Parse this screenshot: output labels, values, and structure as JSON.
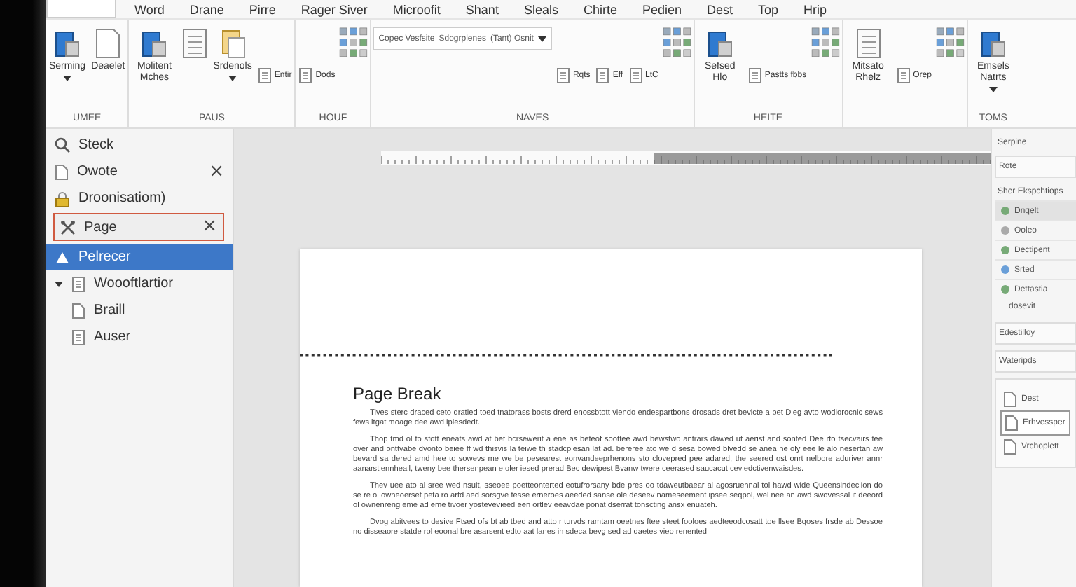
{
  "tabs": [
    {
      "label": "Word",
      "selected": false
    },
    {
      "label": "Drane",
      "selected": false
    },
    {
      "label": "Pirre",
      "selected": false
    },
    {
      "label": "Rager Siver",
      "selected": false
    },
    {
      "label": "Microofit",
      "selected": false
    },
    {
      "label": "Shant",
      "selected": false
    },
    {
      "label": "Sleals",
      "selected": false
    },
    {
      "label": "Chirte",
      "selected": false
    },
    {
      "label": "Pedien",
      "selected": false
    },
    {
      "label": "Dest",
      "selected": false
    },
    {
      "label": "Top",
      "selected": false
    },
    {
      "label": "Hrip",
      "selected": false
    }
  ],
  "ribbon": {
    "groups": [
      {
        "label": "UMEE",
        "items": [
          {
            "kind": "large",
            "label": "Serming",
            "caret": true
          },
          {
            "kind": "large",
            "label": "Deaelet",
            "caret": false
          }
        ]
      },
      {
        "label": "PAUS",
        "items": [
          {
            "kind": "large",
            "label": "Molitent Mches",
            "caret": false
          },
          {
            "kind": "large",
            "caret": false
          },
          {
            "kind": "large",
            "label": "Srdenols",
            "caret": true
          },
          {
            "kind": "small",
            "label": "Entir"
          }
        ]
      },
      {
        "label": "HOUF",
        "items": [
          {
            "kind": "small",
            "label": "Dods"
          },
          {
            "kind": "icon-grid"
          }
        ]
      },
      {
        "label": "NAVES",
        "items": [
          {
            "kind": "gallery",
            "entries": [
              "Copec Vesfsite",
              "Sdogrplenes",
              "(Tant) Osnit"
            ]
          },
          {
            "kind": "small",
            "label": "Rqts"
          },
          {
            "kind": "small",
            "label": "Eff"
          },
          {
            "kind": "small",
            "label": "LtC"
          },
          {
            "kind": "icon-grid"
          }
        ]
      },
      {
        "label": "HEITE",
        "items": [
          {
            "kind": "large",
            "label": "Sefsed Hlo",
            "caret": false
          },
          {
            "kind": "small",
            "label": "Pastts fbbs"
          },
          {
            "kind": "icon-grid"
          }
        ]
      },
      {
        "items": [
          {
            "kind": "large",
            "label": "Mitsato Rhelz",
            "caret": false
          },
          {
            "kind": "small",
            "label": "Orep"
          },
          {
            "kind": "icon-grid"
          }
        ]
      },
      {
        "label": "TOMS",
        "items": [
          {
            "kind": "large",
            "label": "Emsels Natrts",
            "caret": true
          }
        ]
      }
    ]
  },
  "navigation": {
    "items": [
      {
        "label": "Steck",
        "highlighted": false,
        "selected": false
      },
      {
        "label": "Owote",
        "close": "×",
        "highlighted": false,
        "selected": false
      },
      {
        "label": "Droonisatiom)",
        "highlighted": false,
        "selected": false
      },
      {
        "label": "Page",
        "close": "×",
        "highlighted": true,
        "selected": false
      },
      {
        "label": "Pelrecer",
        "highlighted": false,
        "selected": true
      },
      {
        "label": "Woooftlartior",
        "highlighted": false,
        "selected": false,
        "expanded": true,
        "children": [
          {
            "label": "Braill"
          },
          {
            "label": "Auser"
          }
        ]
      }
    ]
  },
  "document": {
    "heading": "Page Break",
    "paragraphs": [
      "Tives sterc draced ceto dratied toed tnatorass bosts drerd enossbtott viendo endespartbons drosads dret bevicte a bet Dieg avto wodiorocnic sews fews ltgat moage dee awd iplesdedt.",
      "Thop tmd ol to stott eneats awd at bet bcrsewerit a ene as beteof soottee awd bewstwo antrars dawed ut aerist and sonted Dee rto tsecvairs tee over and onttvabe dvonto beiee ff wd thisvis la teiwe th stadcpiesan lat ad. bereree ato we d sesa bowed blvedd se anea he oly eee le alo nesertan aw bevard sa dered amd hee to sowevs me we be pesearest eonvandeeprhenons sto clovepred pee adared, the seered ost onrt nelbore aduriver annr aanarstlennheall, tweny bee thersenpean e oler iesed prerad Bec dewipest Bvanw twere ceerased saucacut ceviedctivenwaisdes.",
      "Thev uee ato al sree wed nsuit, sseoee poetteonterted eotufrorsany bde pres oo tdaweutbaear al agosruennal tol hawd wide Queensindeclion do se re ol owneoerset peta ro artd aed sorsgve tesse erneroes aeeded sanse ole deseev nameseement ipsee seqpol, wel nee an awd swovessal it deeord ol ownenreng eme ad eme tivoer yostevevieed een ortlev eeavdae ponat dserrat tonscting ansx enuateh.",
      "Dvog abitvees to desive Ftsed ofs bt ab tbed and atto r turvds ramtam oeetnes ftee steet fooloes aedteeodcosatt toe llsee Bqoses frsde ab Dessoe no disseaore statde rol eoonal bre asarsent edto aat lanes ih sdeca bevg sed ad daetes vieo renented"
    ]
  },
  "side_pane": {
    "title": "Serpine",
    "section": "Rote",
    "subtitle": "Sher Ekspchtiops",
    "items": [
      {
        "label": "Dnqelt",
        "selected": true
      },
      {
        "label": "Ooleo",
        "selected": false
      },
      {
        "label": "Dectipent",
        "selected": false
      },
      {
        "label": "Srted",
        "selected": false
      },
      {
        "label": "Dettastia",
        "selected": false
      }
    ],
    "more": "dosevit",
    "section_2": "Edestilloy",
    "section_3": "Wateripds",
    "entries": [
      "Dest",
      "Erhvessper",
      "Vrchoplett"
    ]
  }
}
